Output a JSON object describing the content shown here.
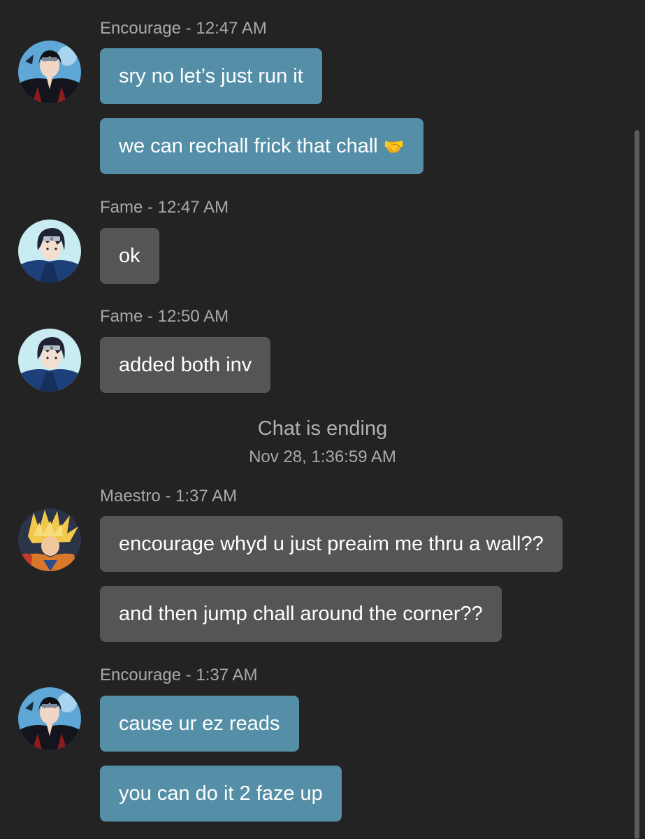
{
  "messages": [
    {
      "author": "Encourage",
      "time": "12:47 AM",
      "header": "Encourage - 12:47 AM",
      "avatar": "itachi-avatar",
      "texts": [
        "sry no let’s just run it",
        "we can rechall frick that chall"
      ],
      "emoji": "🤝"
    },
    {
      "author": "Fame",
      "time": "12:47 AM",
      "header": "Fame - 12:47 AM",
      "avatar": "sasuke-avatar",
      "texts": [
        "ok"
      ]
    },
    {
      "author": "Fame",
      "time": "12:50 AM",
      "header": "Fame - 12:50 AM",
      "avatar": "sasuke-avatar",
      "texts": [
        "added both inv"
      ]
    },
    {
      "author": "Maestro",
      "time": "1:37 AM",
      "header": "Maestro - 1:37 AM",
      "avatar": "goku-avatar",
      "texts": [
        "encourage whyd u just preaim me thru a wall??",
        "and then jump chall around the corner??"
      ]
    },
    {
      "author": "Encourage",
      "time": "1:37 AM",
      "header": "Encourage - 1:37 AM",
      "avatar": "itachi-avatar",
      "texts": [
        "cause ur ez reads",
        "you can do it 2 faze up"
      ]
    }
  ],
  "system": {
    "title": "Chat is ending",
    "timestamp": "Nov 28, 1:36:59 AM"
  },
  "colors": {
    "background": "#232323",
    "own_bubble": "#558fa7",
    "other_bubble": "#555555",
    "meta_text": "#a9a9a9"
  }
}
